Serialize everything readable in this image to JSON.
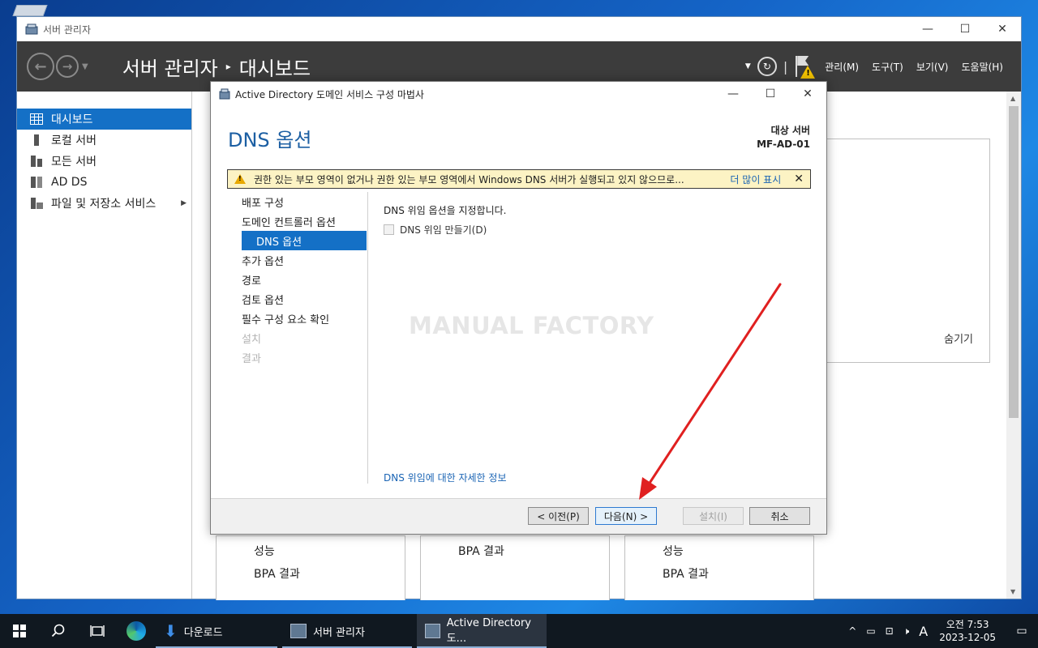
{
  "server_manager": {
    "window_title": "서버 관리자",
    "breadcrumb_root": "서버 관리자",
    "breadcrumb_separator": "▸",
    "breadcrumb_current": "대시보드",
    "menu": [
      "관리(M)",
      "도구(T)",
      "보기(V)",
      "도움말(H)"
    ],
    "sidebar": [
      {
        "label": "대시보드",
        "icon": "dashboard-icon",
        "active": true
      },
      {
        "label": "로컬 서버",
        "icon": "server-icon"
      },
      {
        "label": "모든 서버",
        "icon": "servers-icon"
      },
      {
        "label": "AD DS",
        "icon": "adds-icon"
      },
      {
        "label": "파일 및 저장소 서비스",
        "icon": "storage-icon",
        "expandable": true
      }
    ],
    "hide_link": "숨기기",
    "tiles": [
      {
        "rows": [
          "성능",
          "BPA 결과"
        ]
      },
      {
        "rows": [
          "BPA 결과"
        ]
      },
      {
        "rows": [
          "성능",
          "BPA 결과"
        ]
      }
    ]
  },
  "dialog": {
    "title": "Active Directory 도메인 서비스 구성 마법사",
    "heading": "DNS 옵션",
    "target_label": "대상 서버",
    "target_server": "MF-AD-01",
    "warning_text": "권한 있는 부모 영역이 없거나 권한 있는 부모 영역에서 Windows DNS 서버가 실행되고 있지 않으므로...",
    "warning_more": "더 많이 표시",
    "steps": [
      {
        "label": "배포 구성",
        "state": "normal"
      },
      {
        "label": "도메인 컨트롤러 옵션",
        "state": "normal"
      },
      {
        "label": "DNS 옵션",
        "state": "active"
      },
      {
        "label": "추가 옵션",
        "state": "normal"
      },
      {
        "label": "경로",
        "state": "normal"
      },
      {
        "label": "검토 옵션",
        "state": "normal"
      },
      {
        "label": "필수 구성 요소 확인",
        "state": "normal"
      },
      {
        "label": "설치",
        "state": "disabled"
      },
      {
        "label": "결과",
        "state": "disabled"
      }
    ],
    "description": "DNS 위임 옵션을 지정합니다.",
    "checkbox_label": "DNS 위임 만들기(D)",
    "checkbox_checked": false,
    "watermark": "MANUAL FACTORY",
    "more_info_link": "DNS 위임에 대한 자세한 정보",
    "buttons": {
      "prev": "< 이전(P)",
      "next": "다음(N) >",
      "install": "설치(I)",
      "cancel": "취소"
    }
  },
  "taskbar": {
    "apps": [
      {
        "label": "다운로드",
        "icon": "download-folder-icon"
      },
      {
        "label": "서버 관리자",
        "icon": "server-manager-icon"
      },
      {
        "label": "Active Directory 도...",
        "icon": "ad-wizard-icon",
        "active": true
      }
    ],
    "ime": "A",
    "time": "오전 7:53",
    "date": "2023-12-05"
  },
  "colors": {
    "accent": "#1470c6",
    "header_bg": "#3c3c3c",
    "heading": "#1c5fa3",
    "warning_bg": "#fcf3c4",
    "annotation_arrow": "#e02020"
  }
}
